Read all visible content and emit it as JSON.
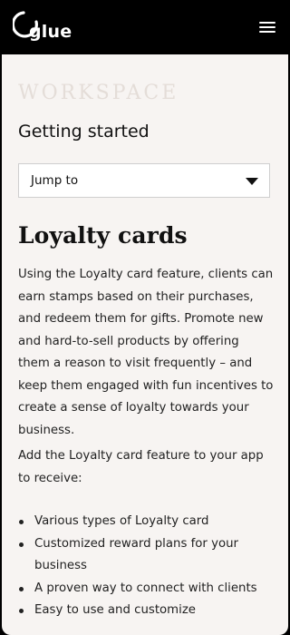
{
  "header": {
    "logo_text": "glue",
    "menu_icon": "hamburger-menu-icon"
  },
  "section": {
    "label": "WORKSPACE",
    "title": "Getting started"
  },
  "jump": {
    "selected": "Jump to"
  },
  "article": {
    "heading": "Loyalty cards",
    "paragraph1": "Using the Loyalty card feature, clients can earn stamps based on their purchases, and redeem them for gifts. Promote new and hard-to-sell products by offering them a reason to visit frequently – and keep them engaged with fun incentives to create a sense of loyalty towards your business.",
    "paragraph2": "Add the Loyalty card feature to your app to receive:",
    "bullets": [
      "Various types of Loyalty card",
      "Customized reward plans for your business",
      "A proven way to connect with clients",
      "Easy to use and customize"
    ]
  },
  "colors": {
    "header_bg": "#000000",
    "panel_bg": "#f7f4f2",
    "section_label": "#e4ddd8"
  }
}
